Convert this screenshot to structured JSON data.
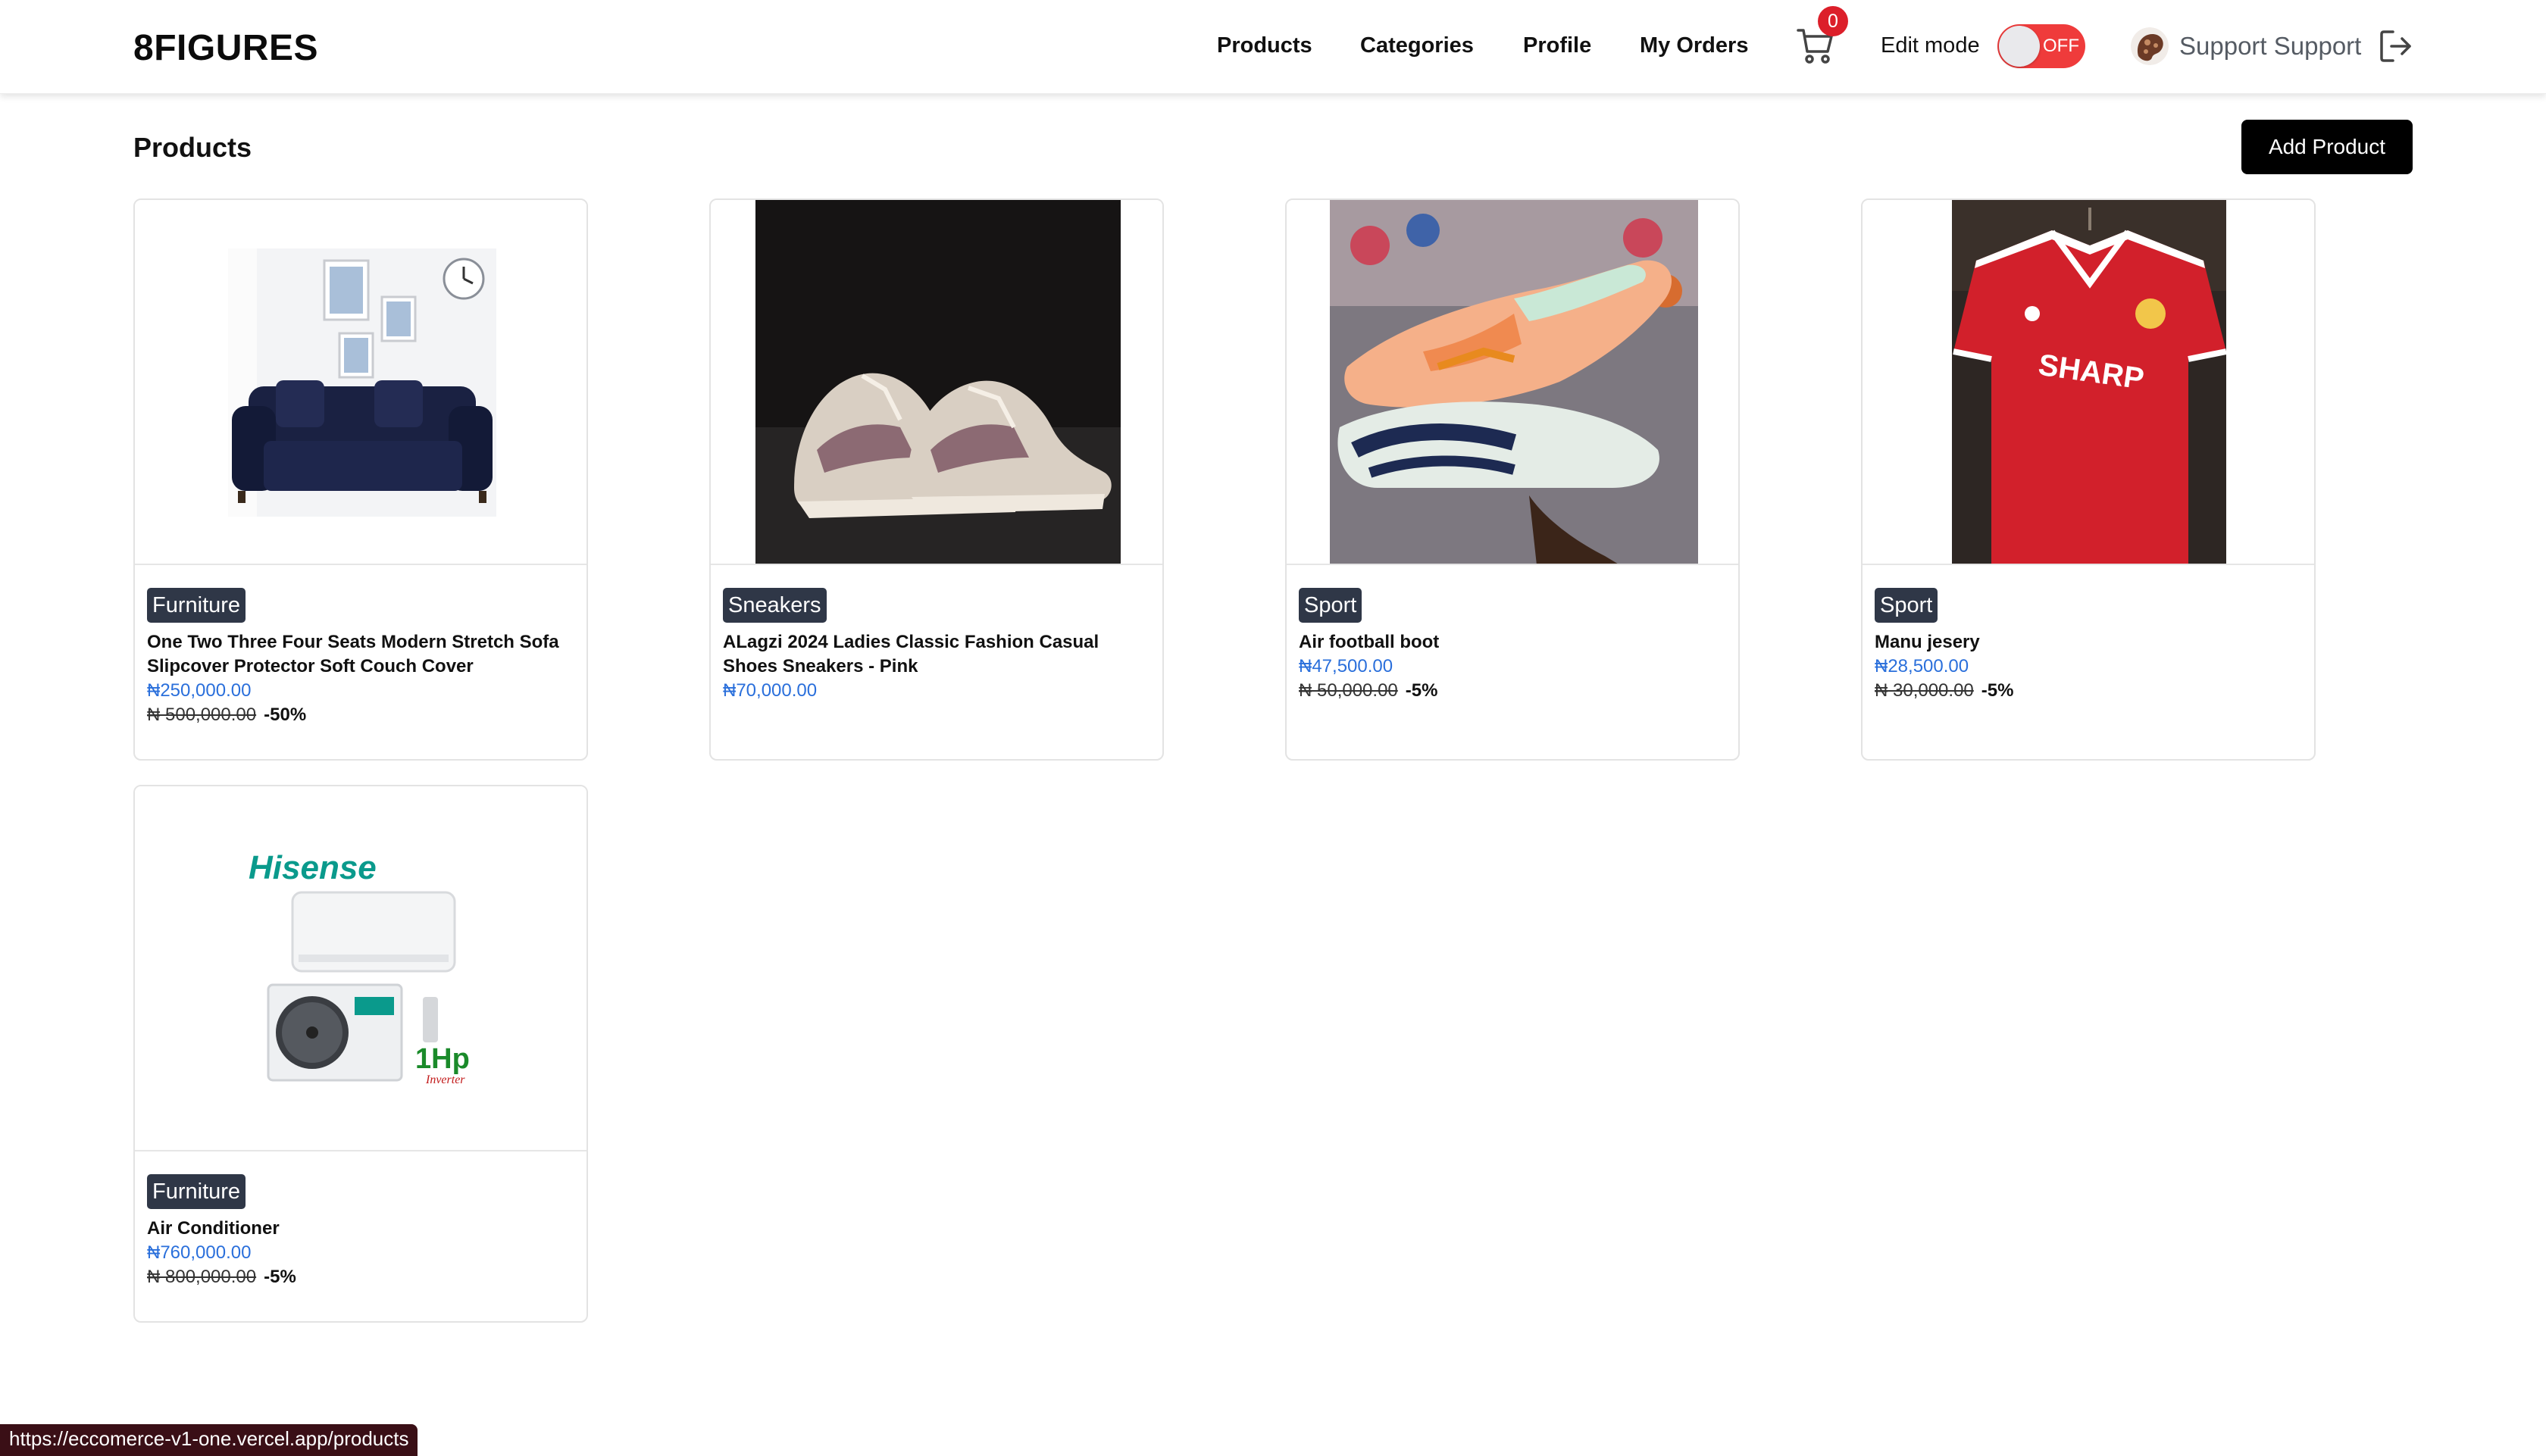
{
  "header": {
    "brand": "8FIGURES",
    "nav": [
      "Products",
      "Categories",
      "Profile",
      "My Orders"
    ],
    "cart_count": "0",
    "edit_mode_label": "Edit mode",
    "edit_mode_state": "OFF",
    "user_name": "Support Support"
  },
  "main": {
    "title": "Products",
    "add_button": "Add Product",
    "products": [
      {
        "category": "Furniture",
        "name": "One Two Three Four Seats Modern Stretch Sofa Slipcover Protector Soft Couch Cover",
        "price": "₦250,000.00",
        "old_price": "₦ 500,000.00",
        "discount": "-50%"
      },
      {
        "category": "Sneakers",
        "name": "ALagzi 2024 Ladies Classic Fashion Casual Shoes Sneakers - Pink",
        "price": "₦70,000.00"
      },
      {
        "category": "Sport",
        "name": "Air football boot",
        "price": "₦47,500.00",
        "old_price": "₦ 50,000.00",
        "discount": "-5%"
      },
      {
        "category": "Sport",
        "name": "Manu jesery",
        "price": "₦28,500.00",
        "old_price": "₦ 30,000.00",
        "discount": "-5%"
      },
      {
        "category": "Furniture",
        "name": "Air Conditioner",
        "price": "₦760,000.00",
        "old_price": "₦ 800,000.00",
        "discount": "-5%",
        "image_text": {
          "brand": "Hisense",
          "rating": "1Hp",
          "sub": "Inverter"
        }
      }
    ]
  },
  "statusbar": {
    "url": "https://eccomerce-v1-one.vercel.app/products"
  },
  "colors": {
    "price_blue": "#2a6fdb",
    "tag_bg": "#2f3747",
    "toggle_red": "#ef3b3b",
    "badge_red": "#dc1f2a"
  },
  "icons": [
    "cart-icon",
    "avatar-image",
    "logout-icon"
  ]
}
